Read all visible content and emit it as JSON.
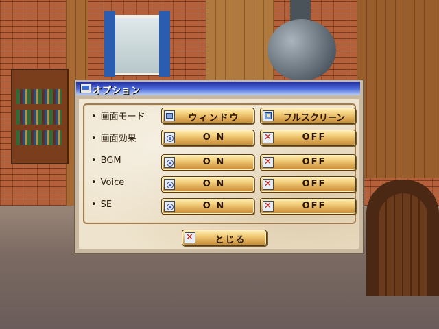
{
  "dialog": {
    "title": "オプション",
    "title_icon": "monitor-icon"
  },
  "options": {
    "bullet": "•",
    "rows": [
      {
        "label": "画面モード",
        "left": {
          "text": "ウィンドウ",
          "icon": "window-icon"
        },
        "right": {
          "text": "フルスクリーン",
          "icon": "fullscreen-icon"
        }
      },
      {
        "label": "画面効果",
        "left": {
          "text": "O N",
          "icon": "on-icon"
        },
        "right": {
          "text": "OFF",
          "icon": "x-icon"
        }
      },
      {
        "label": "BGM",
        "left": {
          "text": "O N",
          "icon": "on-icon"
        },
        "right": {
          "text": "OFF",
          "icon": "x-icon"
        }
      },
      {
        "label": "Voice",
        "left": {
          "text": "O N",
          "icon": "on-icon"
        },
        "right": {
          "text": "OFF",
          "icon": "x-icon"
        }
      },
      {
        "label": "SE",
        "left": {
          "text": "O N",
          "icon": "on-icon"
        },
        "right": {
          "text": "OFF",
          "icon": "x-icon"
        }
      }
    ]
  },
  "close_button": {
    "text": "とじる",
    "icon": "x-icon"
  },
  "colors": {
    "titlebar_start": "#1e2a9a",
    "button_gold": "#f3cf7d",
    "off_x_red": "#cc1c10"
  }
}
